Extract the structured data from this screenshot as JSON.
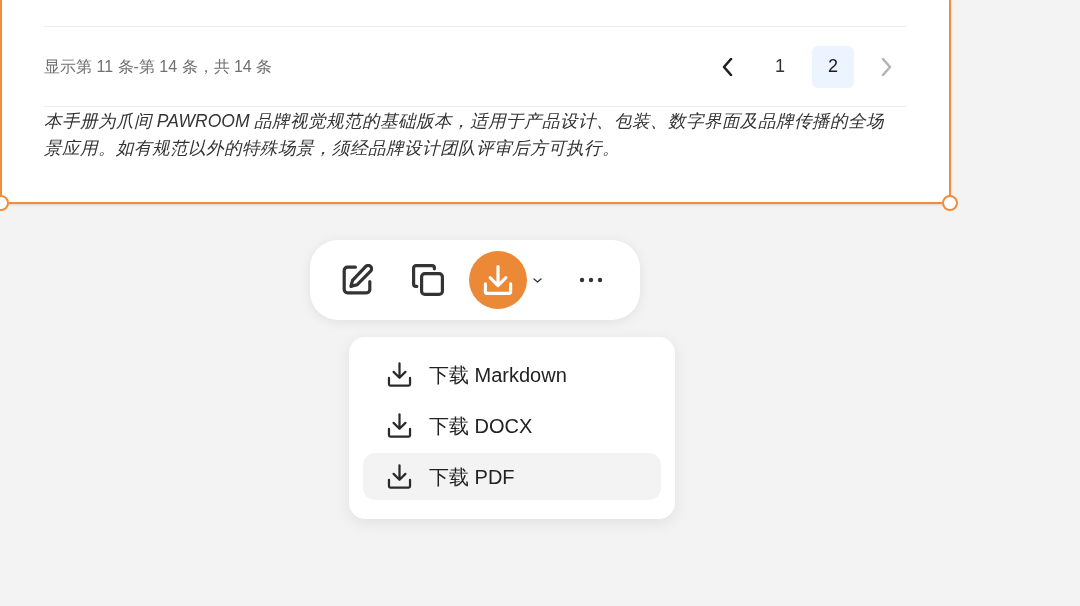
{
  "card": {
    "selected": true,
    "pagination": {
      "summary": "显示第 11 条-第 14 条，共 14 条",
      "prev": {
        "disabled": false
      },
      "pages": [
        {
          "label": "1",
          "selected": false
        },
        {
          "label": "2",
          "selected": true
        }
      ],
      "next": {
        "disabled": true
      }
    },
    "note": "本手册为爪间 PAWROOM 品牌视觉规范的基础版本，适用于产品设计、包装、数字界面及品牌传播的全场景应用。如有规范以外的特殊场景，须经品牌设计团队评审后方可执行。"
  },
  "toolbar": {
    "buttons": [
      {
        "kind": "edit",
        "expanded": false
      },
      {
        "kind": "copy",
        "expanded": false
      },
      {
        "kind": "download",
        "expanded": true
      },
      {
        "kind": "more",
        "expanded": false
      }
    ]
  },
  "download_menu": {
    "items": [
      {
        "label": "下载 Markdown",
        "selected": false
      },
      {
        "label": "下载 DOCX",
        "selected": false
      },
      {
        "label": "下载 PDF",
        "selected": true
      }
    ]
  }
}
